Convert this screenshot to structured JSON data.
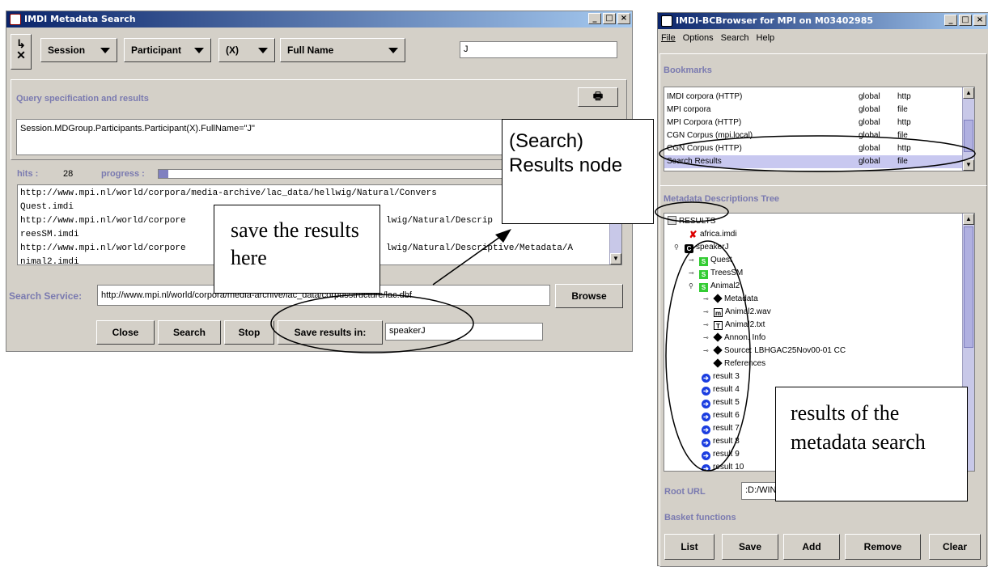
{
  "search_window": {
    "title": "IMDI Metadata Search",
    "combos": [
      "Session",
      "Participant",
      "(X)",
      "Full Name"
    ],
    "query_value": "J",
    "section_query": "Query specification and results",
    "query_text": "Session.MDGroup.Participants.Participant(X).FullName=\"J\"",
    "hits_label": "hits :",
    "hits_value": "28",
    "progress_label": "progress :",
    "progress": 0.02,
    "results": [
      "http://www.mpi.nl/world/corpora/media-archive/lac_data/hellwig/Natural/Convers",
      "Quest.imdi",
      "http://www.mpi.nl/world/corpore",
      "lwig/Natural/Descrip",
      "reesSM.imdi",
      "http://www.mpi.nl/world/corpore",
      "lwig/Natural/Descriptive/Metadata/A",
      "nimal2.imdi"
    ],
    "service_label": "Search Service:",
    "service_url": "http://www.mpi.nl/world/corpora/media-archive/lac_data/corpusstructure/lac.dbf",
    "browse": "Browse",
    "buttons": {
      "close": "Close",
      "search": "Search",
      "stop": "Stop",
      "save_in": "Save results in:"
    },
    "save_value": "speakerJ"
  },
  "browser_window": {
    "title": "IMDI-BCBrowser for MPI on M03402985",
    "menu": [
      "File",
      "Options",
      "Search",
      "Help"
    ],
    "bookmarks_title": "Bookmarks",
    "bookmarks": [
      {
        "name": "IMDI corpora (HTTP)",
        "scope": "global",
        "type": "http"
      },
      {
        "name": "MPI corpora",
        "scope": "global",
        "type": "file"
      },
      {
        "name": "MPI Corpora (HTTP)",
        "scope": "global",
        "type": "http"
      },
      {
        "name": "CGN Corpus (mpi.local)",
        "scope": "global",
        "type": "file"
      },
      {
        "name": "CGN Corpus (HTTP)",
        "scope": "global",
        "type": "http"
      },
      {
        "name": "Search Results",
        "scope": "global",
        "type": "file"
      }
    ],
    "tree_title": "Metadata Descriptions Tree",
    "tree": [
      {
        "label": "RESULTS",
        "icon": "folder-icon"
      },
      {
        "label": "africa.imdi",
        "icon": "error-icon"
      },
      {
        "label": "speakerJ",
        "icon": "corpus-icon"
      },
      {
        "label": "Quest",
        "icon": "session-icon"
      },
      {
        "label": "TreesSM",
        "icon": "session-icon"
      },
      {
        "label": "Animal2",
        "icon": "session-icon"
      },
      {
        "label": "Metadata",
        "icon": "diamond-icon"
      },
      {
        "label": "Animal2.wav",
        "icon": "media-icon"
      },
      {
        "label": "Animal2.txt",
        "icon": "text-icon"
      },
      {
        "label": "Annon. Info",
        "icon": "diamond-icon"
      },
      {
        "label": "Source: LBHGAC25Nov00-01 CC",
        "icon": "diamond-icon"
      },
      {
        "label": "References",
        "icon": "diamond-icon"
      },
      {
        "label": "result 3",
        "icon": "result-icon"
      },
      {
        "label": "result 4",
        "icon": "result-icon"
      },
      {
        "label": "result 5",
        "icon": "result-icon"
      },
      {
        "label": "result 6",
        "icon": "result-icon"
      },
      {
        "label": "result 7",
        "icon": "result-icon"
      },
      {
        "label": "result 8",
        "icon": "result-icon"
      },
      {
        "label": "result 9",
        "icon": "result-icon"
      },
      {
        "label": "result 10",
        "icon": "result-icon"
      }
    ],
    "root_label": "Root URL",
    "root_value": ":D:/WINNT/P",
    "basket_title": "Basket functions",
    "basket_buttons": [
      "List",
      "Save",
      "Add",
      "Remove",
      "Clear"
    ]
  },
  "annotations": {
    "results_node": "(Search) Results node",
    "save_here": "save the results here",
    "search_results": "results of the metadata search"
  }
}
